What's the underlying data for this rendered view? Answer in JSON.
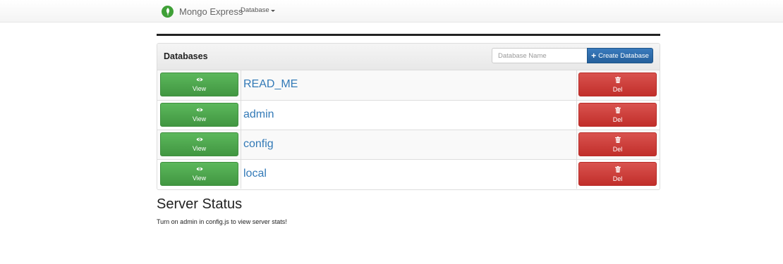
{
  "navbar": {
    "brand": "Mongo Express",
    "menu_label": "Database",
    "logo_icon": "mongo-leaf-icon"
  },
  "panel": {
    "title": "Databases",
    "input_placeholder": "Database Name",
    "input_value": "",
    "create_label": "Create Database",
    "create_icon": "plus-icon"
  },
  "databases": [
    {
      "name": "READ_ME",
      "view_label": "View",
      "del_label": "Del"
    },
    {
      "name": "admin",
      "view_label": "View",
      "del_label": "Del"
    },
    {
      "name": "config",
      "view_label": "View",
      "del_label": "Del"
    },
    {
      "name": "local",
      "view_label": "View",
      "del_label": "Del"
    }
  ],
  "icons": {
    "view": "eye-icon",
    "delete": "trash-icon"
  },
  "server_status": {
    "title": "Server Status",
    "message": "Turn on admin in config.js to view server stats!"
  },
  "colors": {
    "view_button": "#5cb85c",
    "delete_button": "#d9534f",
    "create_button": "#337ab7",
    "link": "#337ab7",
    "logo": "#3fa037"
  }
}
